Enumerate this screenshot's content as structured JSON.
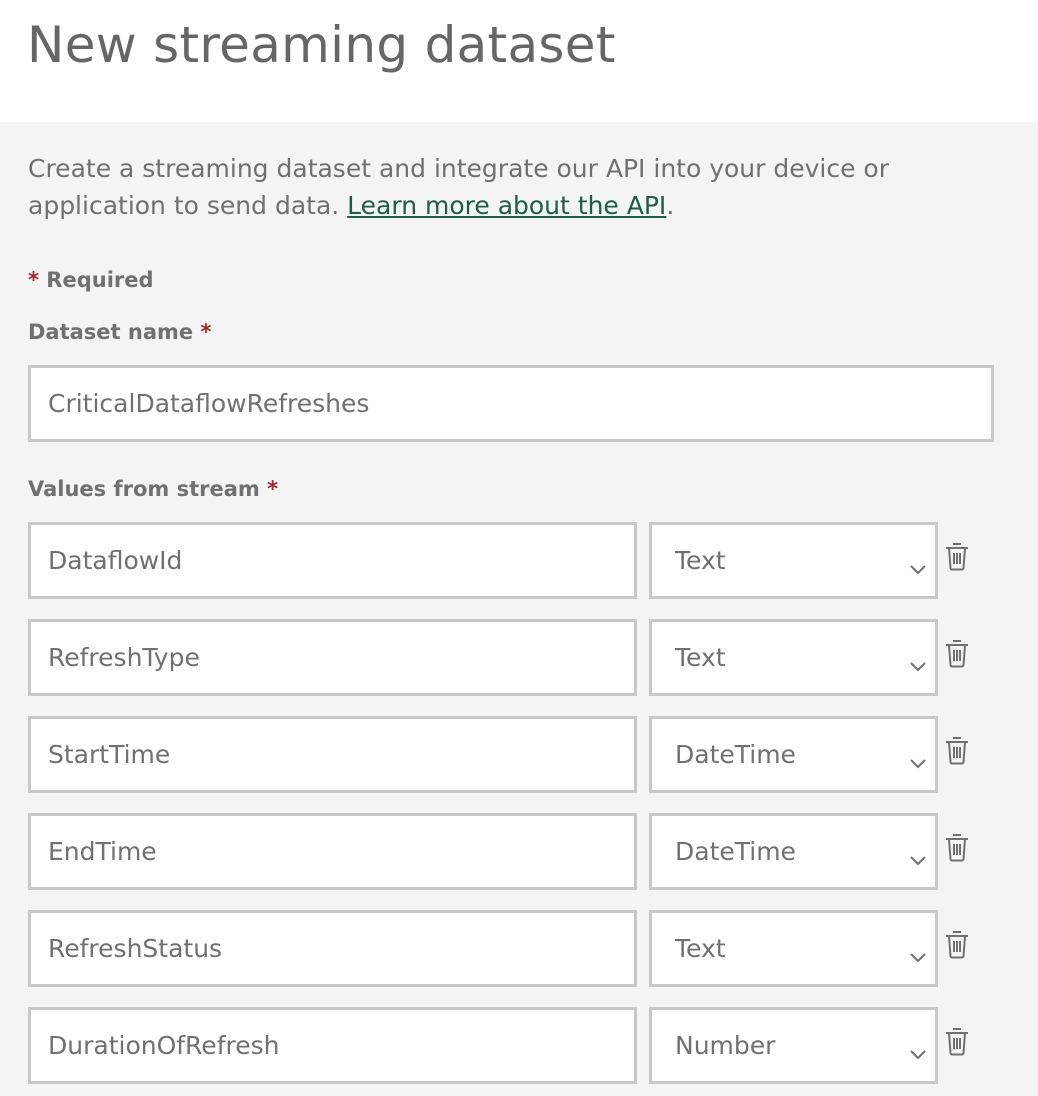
{
  "title": "New streaming dataset",
  "description": {
    "text": "Create a streaming dataset and integrate our API into your device or application to send data. ",
    "link_text": "Learn more about the API",
    "trailing": "."
  },
  "required_note": {
    "star": "*",
    "text": "Required"
  },
  "dataset_name": {
    "label": "Dataset name",
    "star": "*",
    "value": "CriticalDataflowRefreshes"
  },
  "values_section": {
    "label": "Values from stream",
    "star": "*"
  },
  "fields": [
    {
      "name": "DataflowId",
      "type": "Text"
    },
    {
      "name": "RefreshType",
      "type": "Text"
    },
    {
      "name": "StartTime",
      "type": "DateTime"
    },
    {
      "name": "EndTime",
      "type": "DateTime"
    },
    {
      "name": "RefreshStatus",
      "type": "Text"
    },
    {
      "name": "DurationOfRefresh",
      "type": "Number"
    }
  ],
  "icons": {
    "delete": "trash-icon",
    "dropdown": "chevron-down-icon"
  },
  "colors": {
    "required_star": "#a4262c",
    "link": "#1b5e4a",
    "panel_background": "#f4f4f4",
    "input_border": "#c8c8c8"
  }
}
